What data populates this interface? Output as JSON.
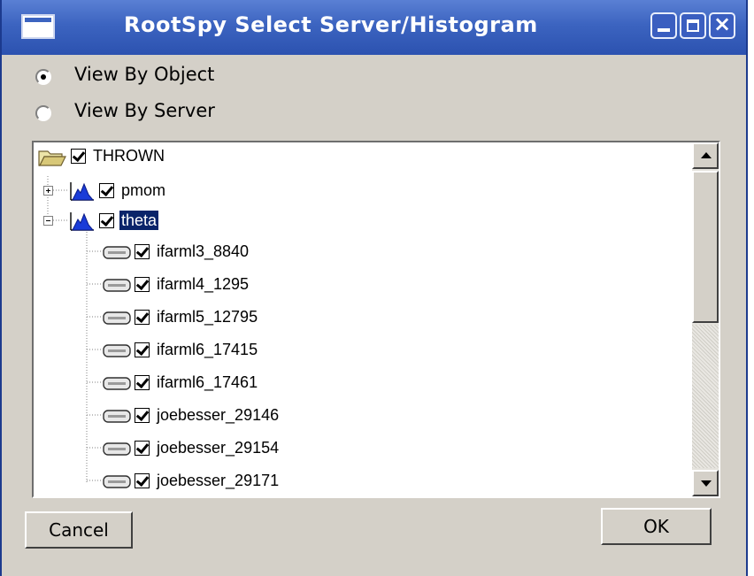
{
  "window": {
    "title": "RootSpy Select Server/Histogram",
    "close_glyph": "×"
  },
  "view_options": [
    {
      "label": "View By Object",
      "selected": true
    },
    {
      "label": "View By Server",
      "selected": false
    }
  ],
  "tree": {
    "root": {
      "label": "THROWN",
      "checked": true,
      "icon": "folder-open-icon"
    },
    "histograms": [
      {
        "label": "pmom",
        "checked": true,
        "expanded": false,
        "selected": false,
        "icon": "histogram-icon"
      },
      {
        "label": "theta",
        "checked": true,
        "expanded": true,
        "selected": true,
        "icon": "histogram-icon"
      }
    ],
    "servers": [
      {
        "label": "ifarml3_8840",
        "checked": true,
        "icon": "server-icon"
      },
      {
        "label": "ifarml4_1295",
        "checked": true,
        "icon": "server-icon"
      },
      {
        "label": "ifarml5_12795",
        "checked": true,
        "icon": "server-icon"
      },
      {
        "label": "ifarml6_17415",
        "checked": true,
        "icon": "server-icon"
      },
      {
        "label": "ifarml6_17461",
        "checked": true,
        "icon": "server-icon"
      },
      {
        "label": "joebesser_29146",
        "checked": true,
        "icon": "server-icon"
      },
      {
        "label": "joebesser_29154",
        "checked": true,
        "icon": "server-icon"
      },
      {
        "label": "joebesser_29171",
        "checked": true,
        "icon": "server-icon"
      }
    ]
  },
  "buttons": {
    "cancel": "Cancel",
    "ok": "OK"
  },
  "colors": {
    "titlebar": "#3c64c0",
    "dialog_bg": "#d4d0c8",
    "selection": "#0a246a"
  }
}
